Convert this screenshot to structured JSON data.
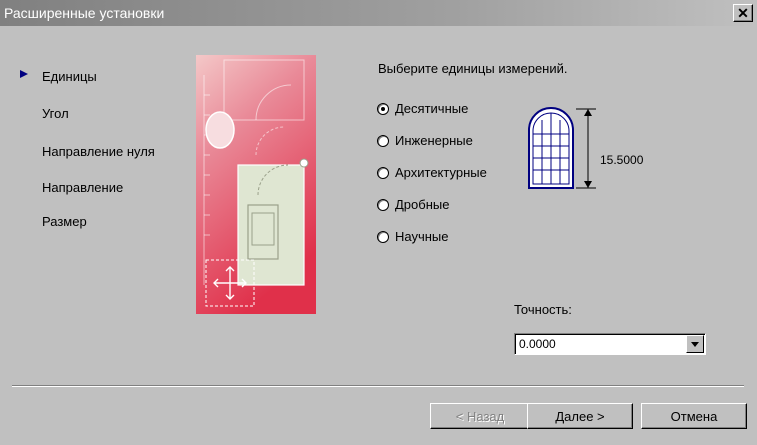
{
  "window": {
    "title": "Расширенные установки",
    "close_glyph": "✕"
  },
  "nav": {
    "items": [
      {
        "label": "Единицы",
        "active": true
      },
      {
        "label": "Угол"
      },
      {
        "label": "Направление нуля"
      },
      {
        "label": "Направление"
      },
      {
        "label": "Размер"
      }
    ]
  },
  "units": {
    "prompt": "Выберите единицы измерений.",
    "options": [
      {
        "label": "Десятичные",
        "checked": true
      },
      {
        "label": "Инженерные",
        "checked": false
      },
      {
        "label": "Архитектурные",
        "checked": false
      },
      {
        "label": "Дробные",
        "checked": false
      },
      {
        "label": "Научные",
        "checked": false
      }
    ],
    "preview_dimension": "15.5000"
  },
  "precision": {
    "label": "Точность:",
    "value": "0.0000"
  },
  "buttons": {
    "back": "< Назад",
    "next": "Далее >",
    "cancel": "Отмена"
  },
  "colors": {
    "nav_arrow": "#000080",
    "illustration_red": "#e0304a",
    "illustration_pink": "#f4c8c8"
  }
}
